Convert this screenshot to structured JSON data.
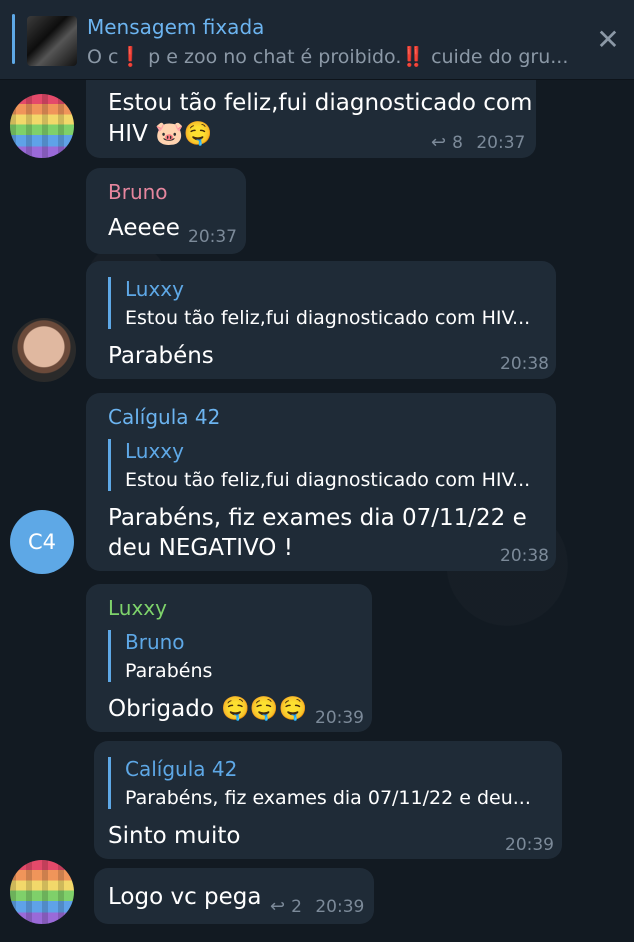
{
  "pinned": {
    "title": "Mensagem fixada",
    "text": "O c❗ p e zoo no chat é proibido.‼️ cuide do gru..."
  },
  "messages": [
    {
      "text_line1": "Estou tão feliz,fui diagnosticado com",
      "text_line2": "HIV 🐷🤤",
      "replies": "8",
      "time": "20:37"
    },
    {
      "sender": "Bruno",
      "text": "Aeeee",
      "time": "20:37"
    },
    {
      "reply_name": "Luxxy",
      "reply_text": "Estou tão feliz,fui diagnosticado com HIV...",
      "text": "Parabéns",
      "time": "20:38"
    },
    {
      "sender": "Calígula 42",
      "reply_name": "Luxxy",
      "reply_text": "Estou tão feliz,fui diagnosticado com HIV...",
      "text_line1": "Parabéns, fiz exames dia 07/11/22  e",
      "text_line2": "deu NEGATIVO  !",
      "time": "20:38",
      "avatar": "C4"
    },
    {
      "sender": "Luxxy",
      "reply_name": "Bruno",
      "reply_text": "Parabéns",
      "text": "Obrigado 🤤🤤🤤",
      "time": "20:39"
    },
    {
      "reply_name": "Calígula 42",
      "reply_text": "Parabéns, fiz exames dia 07/11/22  e deu...",
      "text": "Sinto muito",
      "time": "20:39"
    },
    {
      "text": "Logo vc pega",
      "replies": "2",
      "time": "20:39"
    }
  ],
  "colors": {
    "bruno": "#e6869e",
    "caligula": "#6cb4f0",
    "luxxy": "#7ed36b",
    "accent": "#5ea8e6"
  }
}
